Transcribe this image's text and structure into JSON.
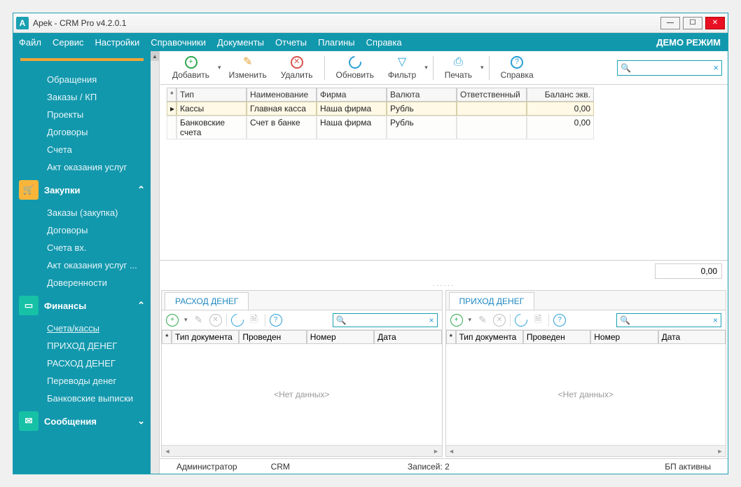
{
  "window": {
    "app_icon": "A",
    "title": "Apek - CRM Pro v4.2.0.1"
  },
  "menubar": [
    "Файл",
    "Сервис",
    "Настройки",
    "Справочники",
    "Документы",
    "Отчеты",
    "Плагины",
    "Справка"
  ],
  "menubar_right": "ДЕМО РЕЖИМ",
  "toolbar": {
    "add": "Добавить",
    "edit": "Изменить",
    "delete": "Удалить",
    "refresh": "Обновить",
    "filter": "Фильтр",
    "print": "Печать",
    "help": "Справка"
  },
  "sidebar": {
    "items1": [
      "Обращения",
      "Заказы / КП",
      "Проекты",
      "Договоры",
      "Счета",
      "Акт оказания услуг"
    ],
    "purchases": {
      "title": "Закупки",
      "items": [
        "Заказы (закупка)",
        "Договоры",
        "Счета вх.",
        "Акт оказания услуг ...",
        "Доверенности"
      ]
    },
    "finance": {
      "title": "Финансы",
      "items": [
        "Счета/кассы",
        "ПРИХОД ДЕНЕГ",
        "РАСХОД ДЕНЕГ",
        "Переводы денег",
        "Банковские выписки"
      ]
    },
    "messages": {
      "title": "Сообщения"
    }
  },
  "grid": {
    "cols": [
      "Тип",
      "Наименование",
      "Фирма",
      "Валюта",
      "Ответственный",
      "Баланс экв."
    ],
    "rows": [
      {
        "type": "Кассы",
        "name": "Главная касса",
        "firm": "Наша фирма",
        "curr": "Рубль",
        "resp": "",
        "bal": "0,00"
      },
      {
        "type": "Банковские счета",
        "name": "Счет в банке",
        "firm": "Наша фирма",
        "curr": "Рубль",
        "resp": "",
        "bal": "0,00"
      }
    ],
    "total": "0,00"
  },
  "panel_left": {
    "tab": "РАСХОД ДЕНЕГ",
    "cols": [
      "Тип документа",
      "Проведен",
      "Номер",
      "Дата"
    ],
    "nodata": "<Нет данных>"
  },
  "panel_right": {
    "tab": "ПРИХОД ДЕНЕГ",
    "cols": [
      "Тип документа",
      "Проведен",
      "Номер",
      "Дата"
    ],
    "nodata": "<Нет данных>"
  },
  "status": {
    "user": "Администратор",
    "db": "CRM",
    "records": "Записей: 2",
    "bp": "БП активны"
  }
}
